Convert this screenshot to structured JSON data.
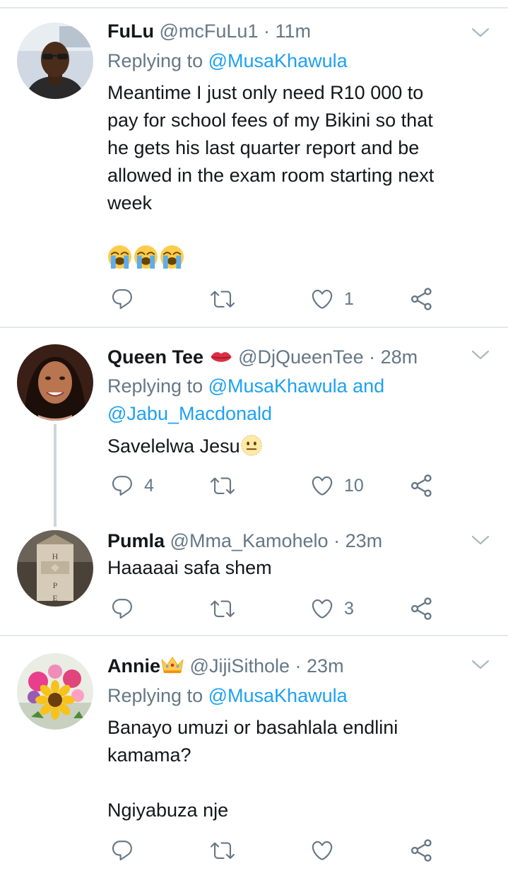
{
  "tweets": [
    {
      "name": "FuLu",
      "handle": "@mcFuLu1",
      "dot": "·",
      "time": "11m",
      "replying_prefix": "Replying to",
      "replying_link": "@MusaKhawula",
      "body_lines": [
        "Meantime I just only need R10 000 to",
        "pay for school fees of my Bikini so that",
        "he gets his last quarter report and be",
        "allowed in the exam room starting next",
        "week"
      ],
      "emojis": [
        "loudly-crying-face",
        "loudly-crying-face",
        "loudly-crying-face"
      ],
      "reply_count": "",
      "like_count": "1"
    },
    {
      "name": "Queen Tee",
      "name_emoji": "kiss-lips",
      "handle": "@DjQueenTee",
      "dot": "·",
      "time": "28m",
      "replying_prefix": "Replying to",
      "replying_link": "@MusaKhawula and",
      "replying_link2": "@Jabu_Macdonald",
      "body": "Savelelwa Jesu",
      "body_emoji": "neutral-face",
      "reply_count": "4",
      "like_count": "10"
    },
    {
      "name": "Pumla",
      "handle": "@Mma_Kamohelo",
      "dot": "·",
      "time": "23m",
      "body": "Haaaaai safa shem",
      "reply_count": "",
      "like_count": "3"
    },
    {
      "name": "Annie",
      "name_emoji": "crown",
      "handle": "@JijiSithole",
      "dot": "·",
      "time": "23m",
      "replying_prefix": "Replying to",
      "replying_link": "@MusaKhawula",
      "body_lines": [
        "Banayo umuzi or basahlala endlini",
        "kamama?",
        "",
        "Ngiyabuza nje"
      ],
      "reply_count": "",
      "like_count": ""
    }
  ],
  "colors": {
    "link": "#1da1f2",
    "secondary": "#657786",
    "divider": "#e1e8ed",
    "thread_line": "#ccd6dd"
  }
}
